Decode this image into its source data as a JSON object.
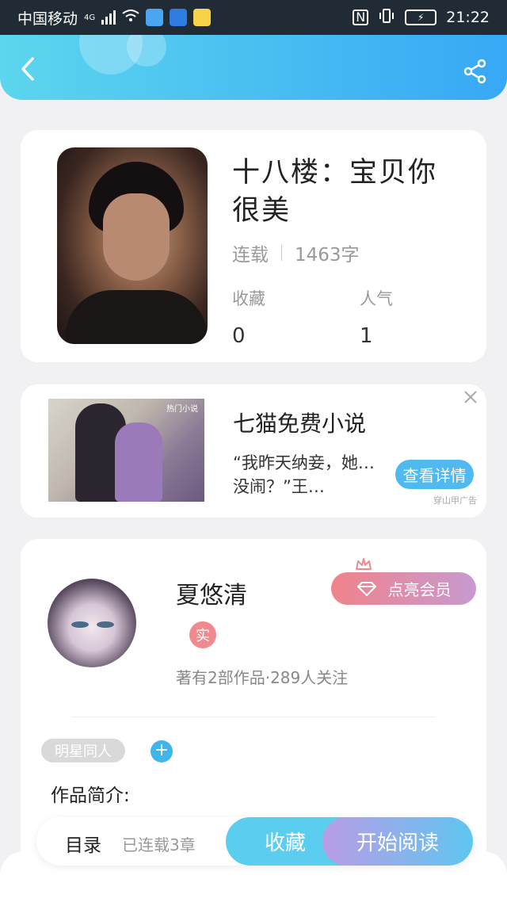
{
  "status_bar": {
    "carrier": "中国移动",
    "network": "4G",
    "time": "21:22",
    "icons": [
      "signal-icon",
      "wifi-icon",
      "app-notification-icon",
      "nfc-icon",
      "vibrate-icon",
      "battery-icon"
    ]
  },
  "header": {
    "back_icon": "chevron-left-icon",
    "share_icon": "share-icon",
    "accent_from": "#5cd6ee",
    "accent_to": "#37a8f5"
  },
  "book": {
    "title": "十八楼：宝贝你很美",
    "status": "连载",
    "word_count": "1463字",
    "favorites_label": "收藏",
    "favorites_value": "0",
    "popularity_label": "人气",
    "popularity_value": "1"
  },
  "ad": {
    "image_tag": "热门小说",
    "title": "七猫免费小说",
    "description": "“我昨天纳妾，她…没闹？”王…",
    "button_label": "查看详情",
    "source": "穿山甲广告"
  },
  "author": {
    "name": "夏悠清",
    "badge": "实",
    "meta": "著有2部作品·289人关注",
    "vip_button": "点亮会员",
    "tag": "明星同人",
    "tag_add": "+",
    "intro_label": "作品简介:"
  },
  "bottom_bar": {
    "toc_label": "目录",
    "chapter_count": "已连载3章",
    "favorite_label": "收藏",
    "read_label": "开始阅读"
  }
}
